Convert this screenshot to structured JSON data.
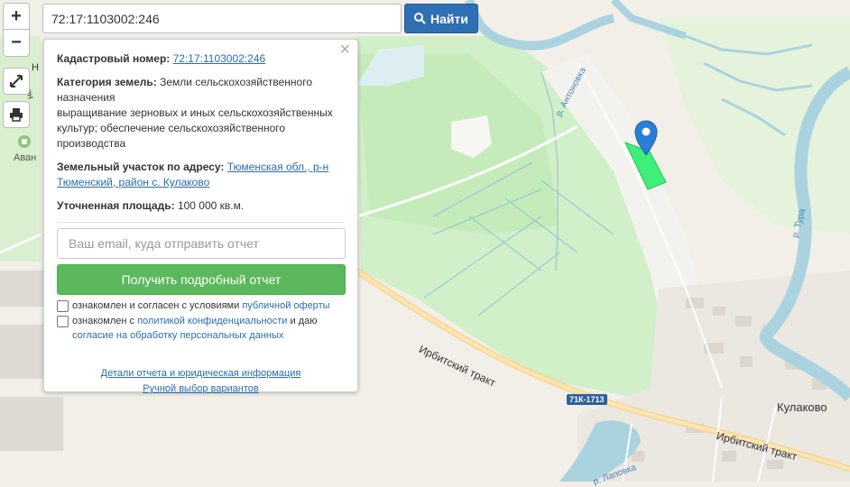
{
  "search": {
    "value": "72:17:1103002:246",
    "button_label": "Найти"
  },
  "zoom": {
    "in_label": "+",
    "out_label": "−"
  },
  "popup": {
    "cadastral_label": "Кадастровый номер:",
    "cadastral_value": "72:17:1103002:246",
    "category_label": "Категория земель:",
    "category_l1": "Земли сельскохозяйственного",
    "category_l2": "назначения",
    "category_l3": "выращивание зерновых и иных сельскохозяйственных",
    "category_l4": "культур; обеспечение сельскохозяйственного",
    "category_l5": "производства",
    "address_label": "Земельный участок по адресу:",
    "address_value_l1": "Тюменская обл., р-н",
    "address_value_l2": "Тюменский, район с. Кулаково",
    "area_label": "Уточненная площадь:",
    "area_value": "100 000 кв.м.",
    "email_placeholder": "Ваш email, куда отправить отчет",
    "report_button": "Получить подробный отчет",
    "consent1_text": "ознакомлен и согласен с условиями",
    "consent1_link": "публичной оферты",
    "consent2_text_a": "ознакомлен с",
    "consent2_link_a": "политикой конфиденциальности",
    "consent2_text_b": "и даю",
    "consent2_link_b": "согласие на обработку персональных данных",
    "footer_link1": "Детали отчета и юридическая информация",
    "footer_link2": "Ручной выбор вариантов",
    "close": "×"
  },
  "map_labels": {
    "irbitsky_1": "Ирбитский тракт",
    "irbitsky_2": "Ирбитский тракт",
    "kulakovo": "Кулаково",
    "antonovka": "р. Антоновка",
    "tura": "р. Тура",
    "road_badge": "71К-1713",
    "avan": "Аван",
    "lapovka": "р. Лаповка",
    "partial_n": "Н",
    "partial_sever": "еверн"
  },
  "colors": {
    "water": "#aad3df",
    "forest": "#c8f0c0",
    "parcel": "#3ef07a",
    "marker": "#2a7ed8",
    "search_button": "#2f6fb4",
    "report_button": "#5cb85c"
  }
}
